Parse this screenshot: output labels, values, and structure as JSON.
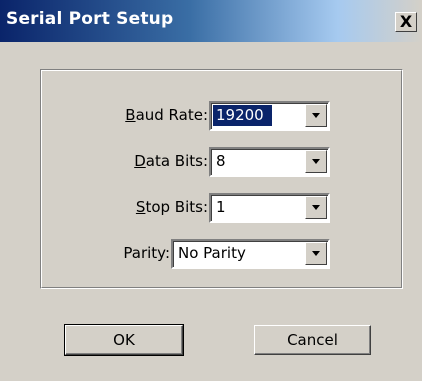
{
  "window": {
    "title": "Serial Port Setup",
    "close_glyph": "X"
  },
  "fields": {
    "baud_rate": {
      "label_accel": "B",
      "label_rest": "aud Rate:",
      "value": "19200"
    },
    "data_bits": {
      "label_accel": "D",
      "label_rest": "ata Bits:",
      "value": "8"
    },
    "stop_bits": {
      "label_accel": "S",
      "label_rest": "top Bits:",
      "value": "1"
    },
    "parity": {
      "label": "Parity:",
      "value": "No Parity"
    }
  },
  "buttons": {
    "ok": "OK",
    "cancel": "Cancel"
  },
  "colors": {
    "title_gradient_start": "#0a246a",
    "title_gradient_end": "#a6caf0",
    "selection": "#0a246a",
    "face": "#d4d0c8"
  },
  "icons": {
    "close": "close-icon",
    "dropdown": "chevron-down-icon"
  }
}
